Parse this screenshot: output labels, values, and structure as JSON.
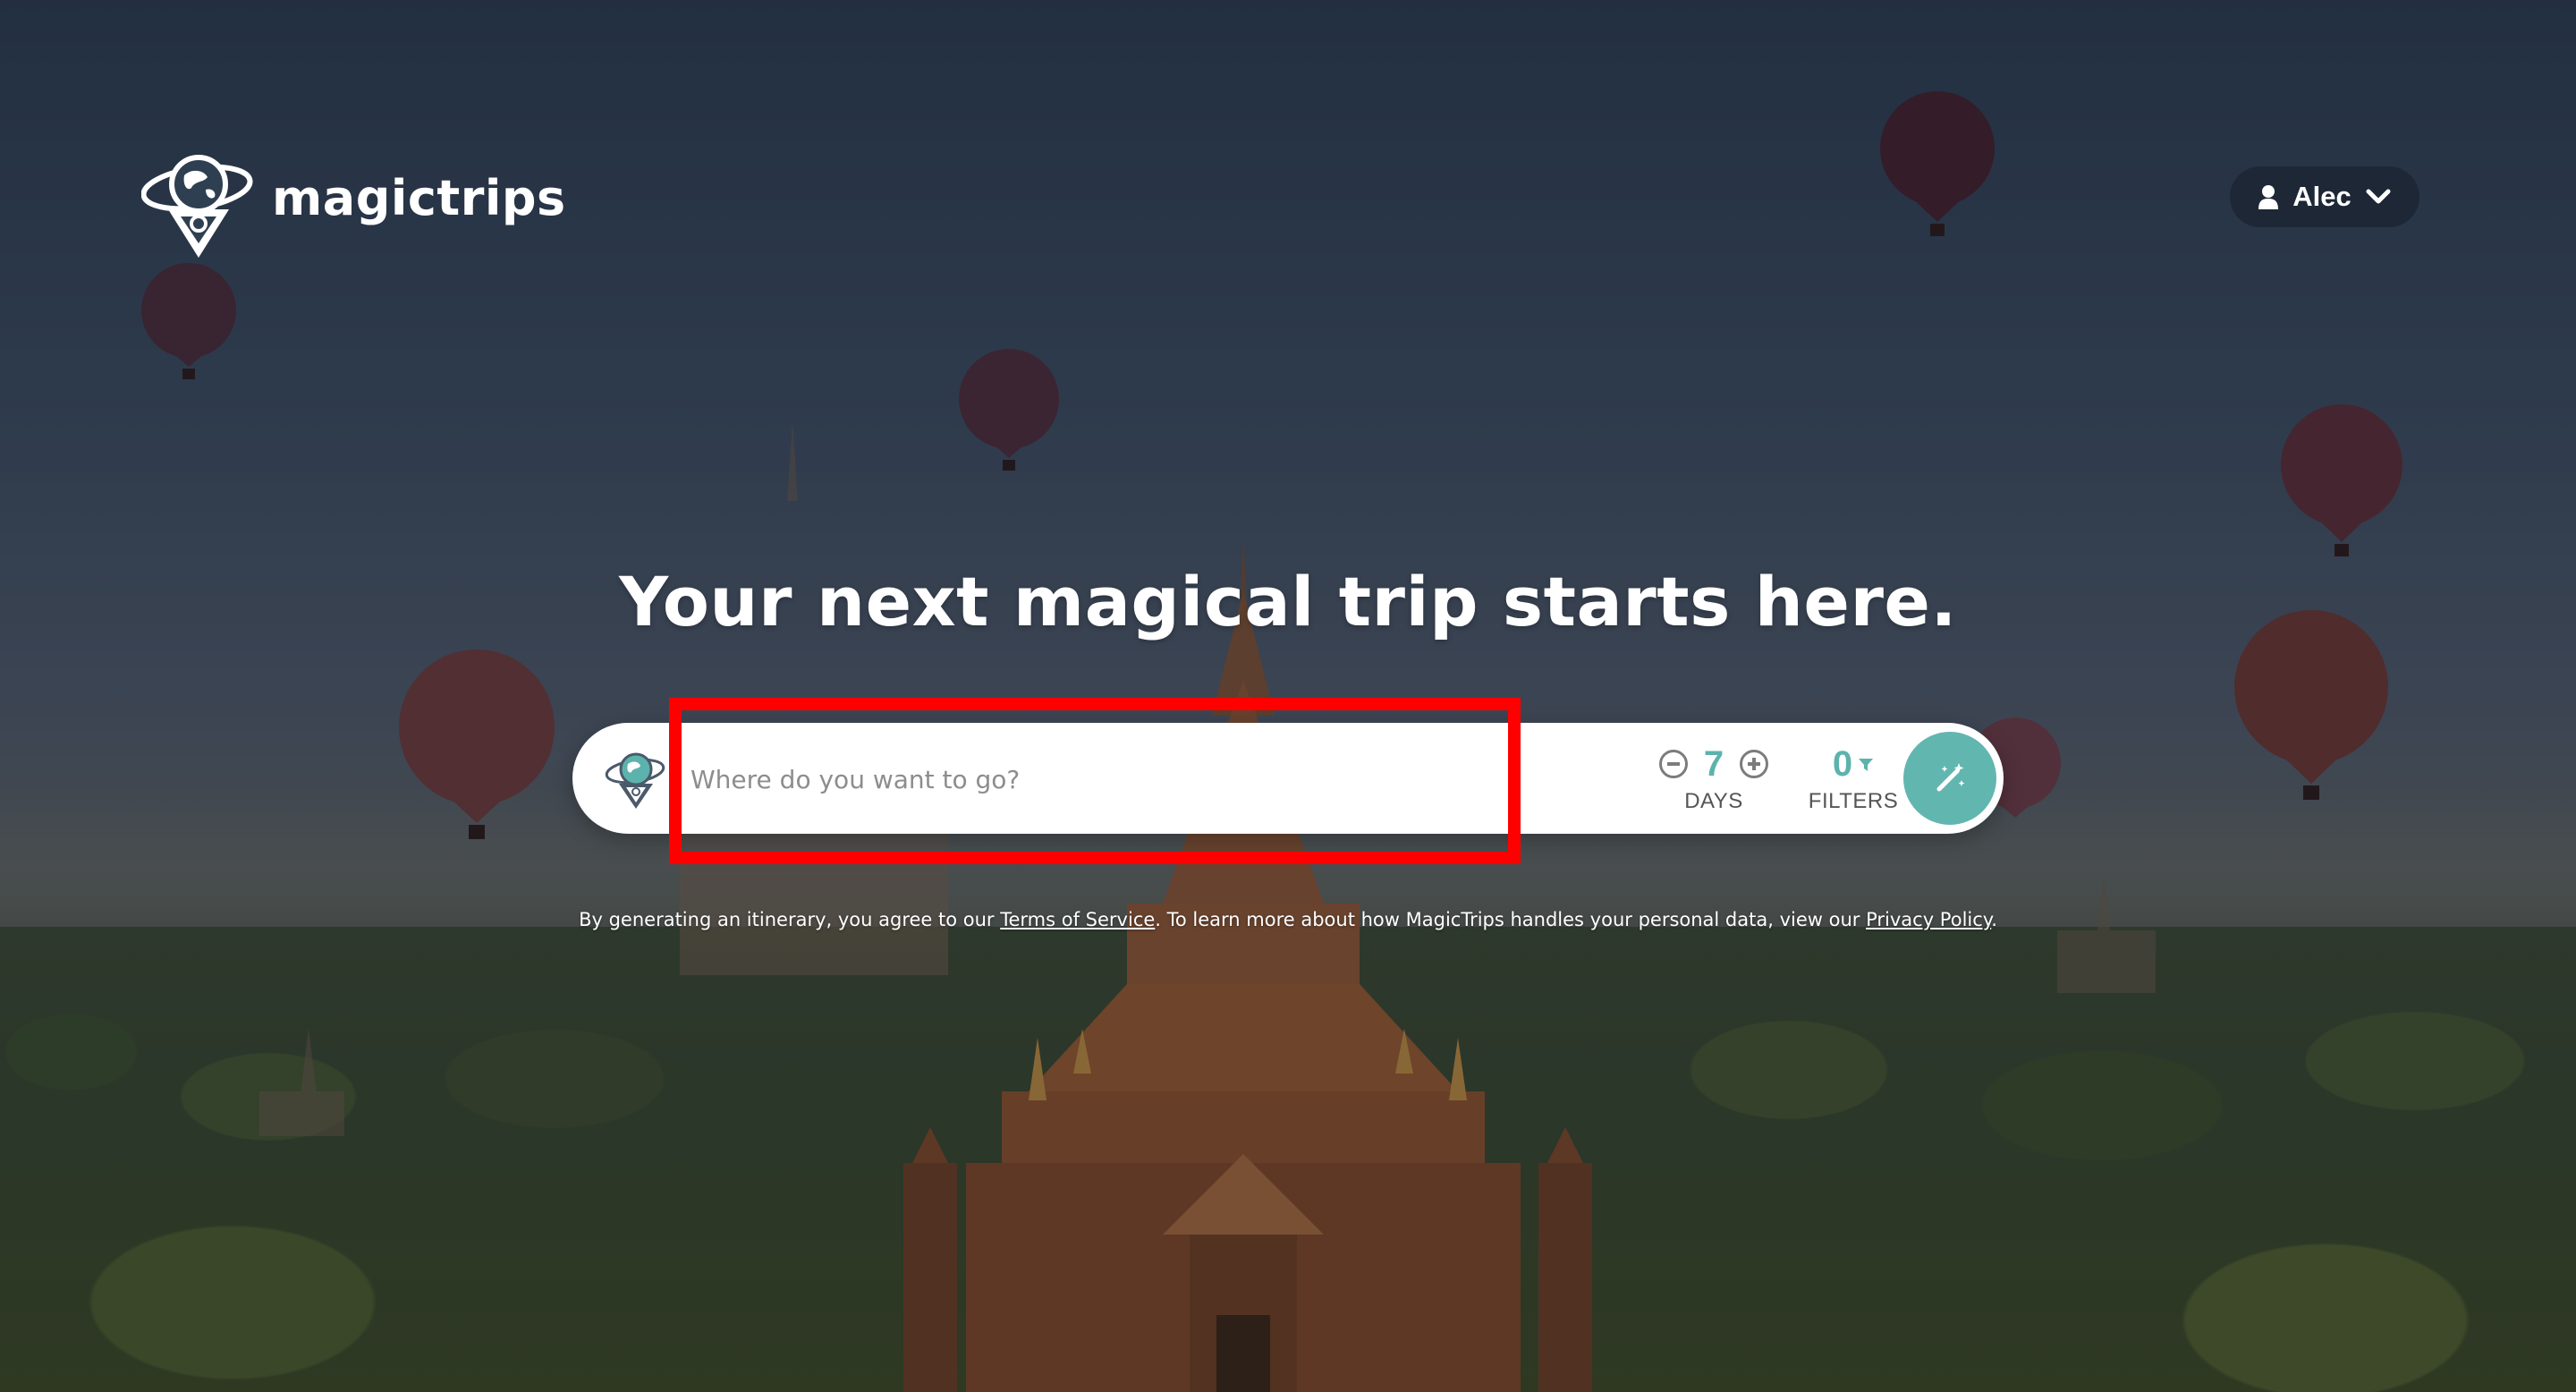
{
  "brand": {
    "name": "magictrips"
  },
  "user_menu": {
    "username": "Alec"
  },
  "hero": {
    "headline": "Your next magical trip starts here."
  },
  "search": {
    "placeholder": "Where do you want to go?",
    "value": ""
  },
  "days": {
    "count": "7",
    "label": "DAYS"
  },
  "filters": {
    "count": "0",
    "label": "FILTERS"
  },
  "legal": {
    "prefix": "By generating an itinerary, you agree to our ",
    "terms_link": "Terms of Service",
    "middle": ". To learn more about how MagicTrips handles your personal data, view our ",
    "privacy_link": "Privacy Policy",
    "suffix": "."
  },
  "colors": {
    "accent": "#5cb3ad",
    "go_button": "#62b6b0",
    "highlight": "#ff0000",
    "user_menu_bg": "#1c2634"
  },
  "icons": {
    "logo": "globe-pin-icon",
    "user": "user-icon",
    "dropdown": "chevron-down-icon",
    "search_globe": "globe-pin-icon",
    "days_decrease": "minus-circle-icon",
    "days_increase": "plus-circle-icon",
    "filters": "funnel-icon",
    "generate": "magic-wand-icon"
  }
}
